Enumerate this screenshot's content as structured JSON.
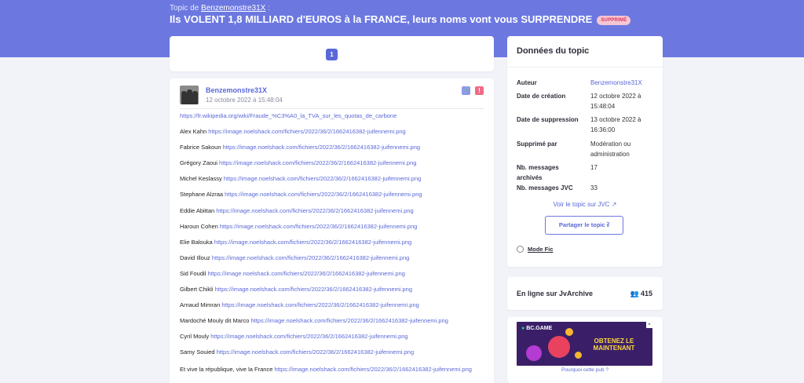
{
  "header": {
    "prefix": "Topic de",
    "author": "Benzemonstre31X",
    "prefix_suffix": " :",
    "title": "Ils VOLENT 1,8 MILLIARD d'EUROS à la FRANCE, leurs noms vont vous SURPRENDRE",
    "badge": "SUPPRIMÉ"
  },
  "pagination": {
    "current_page": "1"
  },
  "post": {
    "author": "Benzemonstre31X",
    "date": "12 octobre 2022 à 15:48:04",
    "first_link": "https://fr.wikipedia.org/wiki/Fraude_%C3%A0_la_TVA_sur_les_quotas_de_carbone",
    "lines": [
      {
        "name": "Alex Kahn",
        "url": "https://image.noelshack.com/fichiers/2022/36/2/1662416382-juifennemi.png"
      },
      {
        "name": "Fabrice Sakoun",
        "url": "https://image.noelshack.com/fichiers/2022/36/2/1662416382-juifennemi.png"
      },
      {
        "name": "Grégory Zaoui",
        "url": "https://image.noelshack.com/fichiers/2022/36/2/1662416382-juifennemi.png"
      },
      {
        "name": "Michel Keslassy",
        "url": "https://image.noelshack.com/fichiers/2022/36/2/1662416382-juifennemi.png"
      },
      {
        "name": "Stephane Alzraa",
        "url": "https://image.noelshack.com/fichiers/2022/36/2/1662416382-juifennemi.png"
      },
      {
        "name": "Eddie Abittan",
        "url": "https://image.noelshack.com/fichiers/2022/36/2/1662416382-juifennemi.png"
      },
      {
        "name": "Haroun Cohen",
        "url": "https://image.noelshack.com/fichiers/2022/36/2/1662416382-juifennemi.png"
      },
      {
        "name": "Elie Balouka",
        "url": "https://image.noelshack.com/fichiers/2022/36/2/1662416382-juifennemi.png"
      },
      {
        "name": "David Illouz",
        "url": "https://image.noelshack.com/fichiers/2022/36/2/1662416382-juifennemi.png"
      },
      {
        "name": "Sid Foudil",
        "url": "https://image.noelshack.com/fichiers/2022/36/2/1662416382-juifennemi.png"
      },
      {
        "name": "Gilbert Chikli",
        "url": "https://image.noelshack.com/fichiers/2022/36/2/1662416382-juifennemi.png"
      },
      {
        "name": "Arnaud Mimran",
        "url": "https://image.noelshack.com/fichiers/2022/36/2/1662416382-juifennemi.png"
      },
      {
        "name": "Mardoché Mouly dit Marco",
        "url": "https://image.noelshack.com/fichiers/2022/36/2/1662416382-juifennemi.png"
      },
      {
        "name": "Cyril Mouly",
        "url": "https://image.noelshack.com/fichiers/2022/36/2/1662416382-juifennemi.png"
      },
      {
        "name": "Samy Souied",
        "url": "https://image.noelshack.com/fichiers/2022/36/2/1662416382-juifennemi.png"
      }
    ],
    "last_text": "Et vive la république, vive la France",
    "last_url": "https://image.noelshack.com/fichiers/2022/36/2/1662416382-juifennemi.png"
  },
  "sidebar": {
    "title": "Données du topic",
    "rows": [
      {
        "key": "Auteur",
        "value": "Benzemonstre31X"
      },
      {
        "key": "Date de création",
        "value": "12 octobre 2022 à 15:48:04"
      },
      {
        "key": "Date de suppression",
        "value": "13 octobre 2022 à 16:36:00"
      },
      {
        "key": "Supprimé par",
        "value": "Modération ou administration"
      },
      {
        "key": "Nb. messages archivés",
        "value": "17"
      },
      {
        "key": "Nb. messages JVC",
        "value": "33"
      }
    ],
    "jvc_link": "Voir le topic sur JVC",
    "share_button": "Partager le topic",
    "fic_mode": "Mode Fic"
  },
  "online": {
    "label": "En ligne sur JvArchive",
    "count": "415"
  },
  "ad": {
    "brand": "BC.GAME",
    "cta": "OBTENEZ LE MAINTENANT",
    "why": "Pourquoi cette pub ?"
  },
  "colors": {
    "header_bg": "#6c78e0",
    "accent": "#5a68d8",
    "badge_bg": "#f7c6d3",
    "badge_text": "#d6335e",
    "alert": "#ef6b87"
  },
  "icons": [
    "link-icon",
    "alert-icon",
    "external-link-icon",
    "share-icon",
    "users-icon"
  ]
}
